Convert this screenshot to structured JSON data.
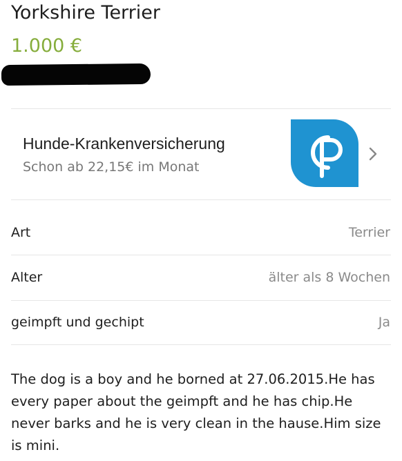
{
  "listing": {
    "title": "Yorkshire Terrier",
    "price": "1.000 €"
  },
  "promo": {
    "title": "Hunde-Krankenversicherung",
    "subtitle": "Schon ab 22,15€ im Monat",
    "logo_icon": "cp-logo-icon",
    "chevron_icon": "chevron-right-icon"
  },
  "attributes": [
    {
      "label": "Art",
      "value": "Terrier"
    },
    {
      "label": "Alter",
      "value": "älter als 8 Wochen"
    },
    {
      "label": "geimpft und gechipt",
      "value": "Ja"
    }
  ],
  "description": "The dog is a boy and he borned at 27.06.2015.He has every paper about the geimpft and he has chip.He never barks and he is very clean in the hause.Him size is mini.",
  "colors": {
    "price": "#86ad3c",
    "logo_background": "#1f93d1",
    "logo_foreground": "#ffffff",
    "divider": "#e6e6e6",
    "muted_text": "#8a8a8a",
    "chevron": "#888888"
  }
}
